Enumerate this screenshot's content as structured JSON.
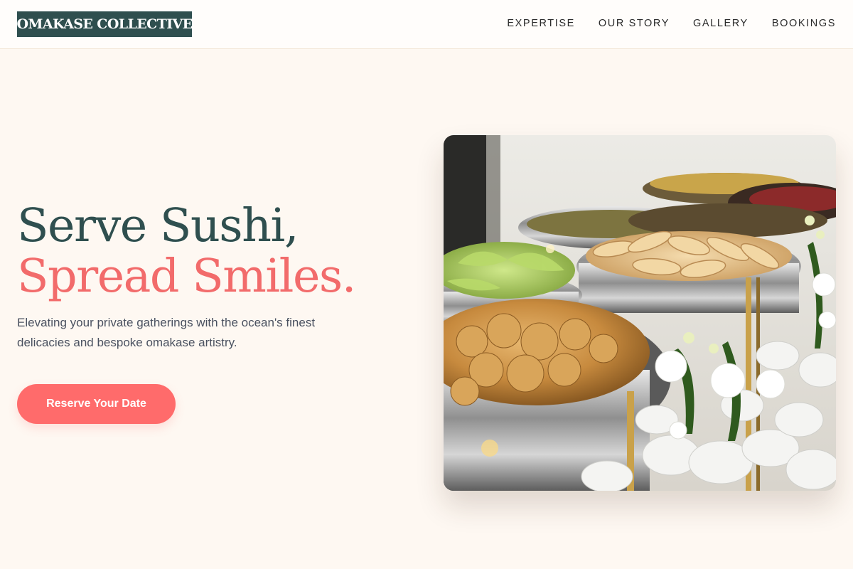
{
  "brand": {
    "logo_text": "OMAKASE COLLECTIVE",
    "primary_color": "#2f4f4f",
    "accent_color": "#ff6b6b",
    "background_color": "#fef8f2"
  },
  "nav": {
    "items": [
      {
        "label": "EXPERTISE"
      },
      {
        "label": "OUR STORY"
      },
      {
        "label": "GALLERY"
      },
      {
        "label": "BOOKINGS"
      }
    ]
  },
  "hero": {
    "headline_line1": "Serve Sushi,",
    "headline_line2": "Spread Smiles.",
    "subcopy": "Elevating your private gatherings with the ocean's finest delicacies and bespoke omakase artistry.",
    "cta_label": "Reserve Your Date",
    "image_subject": "catering buffet with chafing dishes of food and white flowers"
  }
}
